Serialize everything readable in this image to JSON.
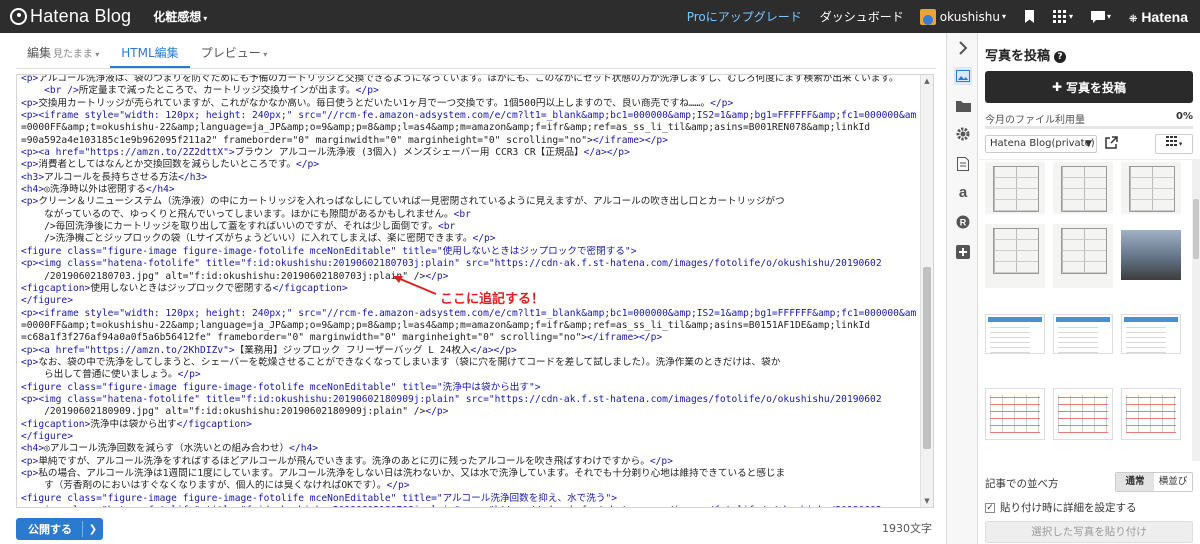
{
  "topbar": {
    "logo_text": "Hatena Blog",
    "blog_name": "化粧感想",
    "upgrade_link": "Proにアップグレード",
    "dashboard_link": "ダッシュボード",
    "username": "okushishu",
    "brand": "Hatena"
  },
  "editor_tabs": [
    {
      "label": "編集",
      "sub": "見たまま",
      "active": false
    },
    {
      "label": "HTML編集",
      "sub": "",
      "active": true
    },
    {
      "label": "プレビュー",
      "sub": "",
      "active": false
    }
  ],
  "code_lines": [
    "<p>アルコール洗浄液は、袋のつまりを防ぐためにも予備のカートリッジと交換できるようになっています。ほかにも、このなかにセット状態の方が洗浄しますし、むしろ何度にまず検索が出来ています。",
    "    <br />所定量まで減ったところで、カートリッジ交換サインが出ます。</p>",
    "<p>交換用カートリッジが売られていますが、これがなかなか高い。毎日使うとだいたい1ヶ月で一つ交換です。1個500円以上しますので、良い商売ですね……。</p>",
    "<p><iframe style=\"width: 120px; height: 240px;\" src=\"//rcm-fe.amazon-adsystem.com/e/cm?lt1=_blank&amp;bc1=000000&amp;IS2=1&amp;bg1=FFFFFF&amp;fc1=000000&amp;lc1",
    "=0000FF&amp;t=okushishu-22&amp;language=ja_JP&amp;o=9&amp;p=8&amp;l=as4&amp;m=amazon&amp;f=ifr&amp;ref=as_ss_li_til&amp;asins=B001REN078&amp;linkId",
    "=90a592a4e103185c1e9b962095f211a2\" frameborder=\"0\" marginwidth=\"0\" marginheight=\"0\" scrolling=\"no\"></iframe></p>",
    "<p><a href=\"https://amzn.to/2Z2dttX\">ブラウン アルコール洗浄液 (3個入) メンズシェーバー用 CCR3 CR【正規品】</a></p>",
    "<p>消費者としてはなんとか交換回数を減らしたいところです。</p>",
    "<h3>アルコールを長持ちさせる方法</h3>",
    "<h4>◎洗浄時以外は密閉する</h4>",
    "<p>クリーン＆リニューシステム（洗浄液）の中にカートリッジを入れっぱなしにしていれば一見密閉されているように見えますが、アルコールの吹き出し口とカートリッジがつ",
    "    ながっているので、ゆっくりと飛んでいってしまいます。ほかにも隙間があるかもしれません。<br",
    "    />毎回洗浄後にカートリッジを取り出して蓋をすればいいのですが、それは少し面倒です。<br",
    "    />洗浄機ごとジップロックの袋（Lサイズがちょうどいい）に入れてしまえば、楽に密閉できます。</p>",
    "<figure class=\"figure-image figure-image-fotolife mceNonEditable\" title=\"使用しないときはジップロックで密閉する\">",
    "<p><img class=\"hatena-fotolife\" title=\"f:id:okushishu:20190602180703j:plain\" src=\"https://cdn-ak.f.st-hatena.com/images/fotolife/o/okushishu/20190602",
    "    /20190602180703.jpg\" alt=\"f:id:okushishu:20190602180703j:plain\" /></p>",
    "<figcaption>使用しないときはジップロックで密閉する</figcaption>",
    "</figure>",
    "<p><iframe style=\"width: 120px; height: 240px;\" src=\"//rcm-fe.amazon-adsystem.com/e/cm?lt1=_blank&amp;bc1=000000&amp;IS2=1&amp;bg1=FFFFFF&amp;fc1=000000&amp;lc1",
    "=0000FF&amp;t=okushishu-22&amp;language=ja_JP&amp;o=9&amp;p=8&amp;l=as4&amp;m=amazon&amp;f=ifr&amp;ref=as_ss_li_til&amp;asins=B0151AF1DE&amp;linkId",
    "=c68a1f3f276af94a0a0f5a6b56412fe\" frameborder=\"0\" marginwidth=\"0\" marginheight=\"0\" scrolling=\"no\"></iframe></p>",
    "<p><a href=\"https://amzn.to/2KhDIZv\">【業務用】ジップロック フリーザーバッグ L 24枚入</a></p>",
    "<p>なお、袋の中で洗浄をしてしまうと、シェーバーを乾燥させることができなくなってしまいます（袋に穴を開けてコードを差して試しました）。洗浄作業のときだけは、袋か",
    "    ら出して普通に使いましょう。</p>",
    "<figure class=\"figure-image figure-image-fotolife mceNonEditable\" title=\"洗浄中は袋から出す\">",
    "<p><img class=\"hatena-fotolife\" title=\"f:id:okushishu:20190602180909j:plain\" src=\"https://cdn-ak.f.st-hatena.com/images/fotolife/o/okushishu/20190602",
    "    /20190602180909.jpg\" alt=\"f:id:okushishu:20190602180909j:plain\" /></p>",
    "<figcaption>洗浄中は袋から出す</figcaption>",
    "</figure>",
    "<h4>◎アルコール洗浄回数を減らす（水洗いとの組み合わせ）</h4>",
    "<p>単純ですが、アルコール洗浄をすればするほどアルコールが飛んでいきます。洗浄のあとに刃に残ったアルコールを吹き飛ばすわけですから。</p>",
    "<p>私の場合、アルコール洗浄は1週間に1度にしています。アルコール洗浄をしない日は洗わないか、又は水で洗浄しています。それでも十分剃り心地は維持できていると感じま",
    "    す（芳香剤のにおいはすぐなくなりますが、個人的には臭くなければOKです）。</p>",
    "<figure class=\"figure-image figure-image-fotolife mceNonEditable\" title=\"アルコール洗浄回数を抑え、水で洗う\">",
    "<p><img class=\"hatena-fotolife\" title=\"f:id:okushishu:20190602180708j:plain\" src=\"https://cdn-ak.f.st-hatena.com/images/fotolife/o/okushishu/20190602"
  ],
  "annotation": "ここに追記する！",
  "publish_button": "公開する",
  "char_count": "1930文字",
  "panel": {
    "title": "写真を投稿",
    "post_button": "写真を投稿",
    "usage_label": "今月のファイル利用量",
    "usage_value": "0%",
    "folder": "Hatena Blog(private)",
    "sort_label": "記事での並べ方",
    "sort_options": [
      "通常",
      "横並び"
    ],
    "detail_checkbox": "貼り付け時に詳細を設定する",
    "paste_button": "選択した写真を貼り付け"
  },
  "rail_icons": [
    "chevron-right-icon",
    "photo-icon",
    "folder-icon",
    "gear-icon",
    "document-icon",
    "amazon-icon",
    "registered-icon",
    "plus-icon"
  ],
  "colors": {
    "accent": "#2a7bd0",
    "topbar": "#2d2d2d",
    "annotation": "#e02020"
  }
}
